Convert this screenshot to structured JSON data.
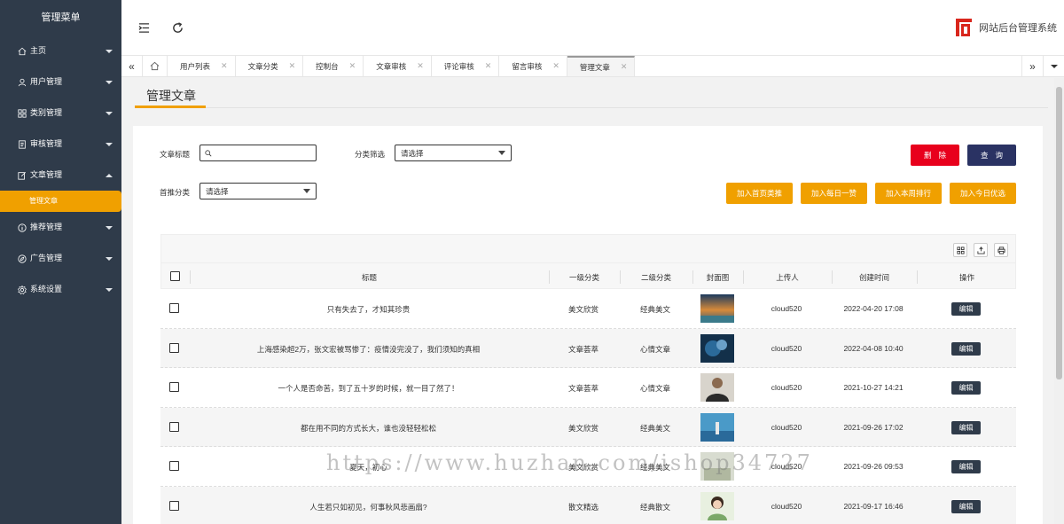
{
  "sidebar": {
    "title": "管理菜单",
    "items": [
      {
        "label": "主页",
        "icon": "home-icon",
        "expanded": false
      },
      {
        "label": "用户管理",
        "icon": "user-icon",
        "expanded": false
      },
      {
        "label": "类别管理",
        "icon": "grid-icon",
        "expanded": false
      },
      {
        "label": "审核管理",
        "icon": "document-icon",
        "expanded": false
      },
      {
        "label": "文章管理",
        "icon": "edit-icon",
        "expanded": true
      },
      {
        "label": "推荐管理",
        "icon": "info-icon",
        "expanded": false
      },
      {
        "label": "广告管理",
        "icon": "compass-icon",
        "expanded": false
      },
      {
        "label": "系统设置",
        "icon": "gear-icon",
        "expanded": false
      }
    ],
    "active_subitem": "管理文章",
    "accent_color": "#f0a000",
    "bg_color": "#2f3b4a"
  },
  "header": {
    "brand_text": "网站后台管理系统",
    "brand_color": "#d9261c"
  },
  "tabs": [
    {
      "label": "用户列表",
      "active": false
    },
    {
      "label": "文章分类",
      "active": false
    },
    {
      "label": "控制台",
      "active": false
    },
    {
      "label": "文章审核",
      "active": false
    },
    {
      "label": "评论审核",
      "active": false
    },
    {
      "label": "留言审核",
      "active": false
    },
    {
      "label": "管理文章",
      "active": true
    }
  ],
  "page": {
    "title": "管理文章"
  },
  "filters": {
    "title_label": "文章标题",
    "title_value": "",
    "category_label": "分类筛选",
    "category_value": "请选择",
    "recommend_label": "首推分类",
    "recommend_value": "请选择"
  },
  "buttons": {
    "delete": "删除",
    "query": "查询",
    "add_home": "加入首页类推",
    "add_daily": "加入每日一赞",
    "add_weekly": "加入本周排行",
    "add_today": "加入今日优选"
  },
  "table": {
    "columns": [
      "标题",
      "一级分类",
      "二级分类",
      "封面图",
      "上传人",
      "创建时间",
      "操作"
    ],
    "edit_label": "编辑",
    "rows": [
      {
        "title": "只有失去了，才知其珍贵",
        "cat1": "美文欣赏",
        "cat2": "经典美文",
        "uploader": "cloud520",
        "created": "2022-04-20 17:08"
      },
      {
        "title": "上海感染超2万，张文宏被骂惨了：疫情没完没了，我们须知的真相",
        "cat1": "文章荟萃",
        "cat2": "心情文章",
        "uploader": "cloud520",
        "created": "2022-04-08 10:40"
      },
      {
        "title": "一个人是否命苦，到了五十岁的时候，就一目了然了！",
        "cat1": "文章荟萃",
        "cat2": "心情文章",
        "uploader": "cloud520",
        "created": "2021-10-27 14:21"
      },
      {
        "title": "都在用不同的方式长大，谁也没轻轻松松",
        "cat1": "美文欣赏",
        "cat2": "经典美文",
        "uploader": "cloud520",
        "created": "2021-09-26 17:02"
      },
      {
        "title": "夏天，初心",
        "cat1": "美文欣赏",
        "cat2": "经典美文",
        "uploader": "cloud520",
        "created": "2021-09-26 09:53"
      },
      {
        "title": "人生若只如初见，何事秋风悲画扇?",
        "cat1": "散文精选",
        "cat2": "经典散文",
        "uploader": "cloud520",
        "created": "2021-09-17 16:46"
      }
    ]
  },
  "watermark": "https://www.huzhan.com/ishop34727"
}
